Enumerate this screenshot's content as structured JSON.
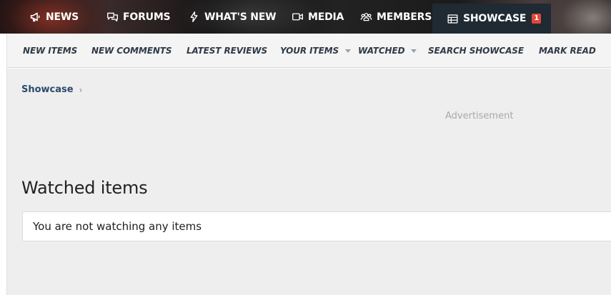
{
  "topnav": {
    "items": [
      {
        "label": "NEWS",
        "icon": "megaphone-icon"
      },
      {
        "label": "FORUMS",
        "icon": "chat-bubbles-icon"
      },
      {
        "label": "WHAT'S NEW",
        "icon": "lightning-bolt-icon"
      },
      {
        "label": "MEDIA",
        "icon": "video-camera-icon"
      },
      {
        "label": "MEMBERS",
        "icon": "users-icon"
      },
      {
        "label": "SHOWCASE",
        "icon": "table-icon",
        "badge": "1",
        "active": true
      }
    ]
  },
  "subnav": {
    "items": [
      {
        "label": "NEW ITEMS"
      },
      {
        "label": "NEW COMMENTS"
      },
      {
        "label": "LATEST REVIEWS"
      },
      {
        "label": "YOUR ITEMS",
        "dropdown": true
      },
      {
        "label": "WATCHED",
        "dropdown": true
      },
      {
        "label": "SEARCH SHOWCASE"
      },
      {
        "label": "MARK READ"
      }
    ]
  },
  "breadcrumb": {
    "items": [
      {
        "label": "Showcase"
      }
    ]
  },
  "advertisement": {
    "label": "Advertisement"
  },
  "page": {
    "title": "Watched items",
    "empty_message": "You are not watching any items"
  },
  "colors": {
    "badge": "#e2463b",
    "active_tab_bg": "#1f2a33",
    "breadcrumb_link": "#2b4a6b",
    "content_bg": "#eeeeee"
  }
}
